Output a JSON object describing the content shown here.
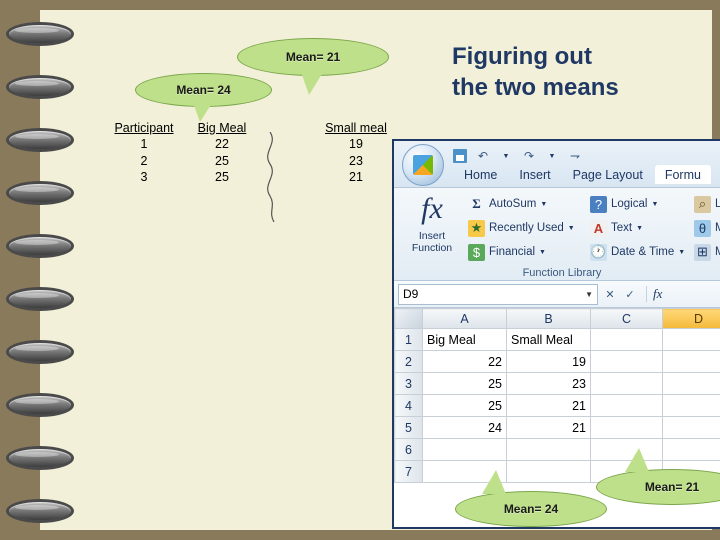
{
  "slide": {
    "title_line1": "Figuring out",
    "title_line2": "the two means",
    "title_color": "#1f3864",
    "background": "#f2f0d8",
    "page_background": "#8a7a5c"
  },
  "callouts": [
    {
      "id": "mean21-top",
      "label": "Mean= 21"
    },
    {
      "id": "mean24-top",
      "label": "Mean= 24"
    },
    {
      "id": "mean21-bottom",
      "label": "Mean= 21"
    },
    {
      "id": "mean24-bottom",
      "label": "Mean= 24"
    }
  ],
  "data_table": {
    "headers": [
      "Participant",
      "Big Meal",
      "",
      "Small meal"
    ],
    "rows": [
      [
        "1",
        "22",
        "",
        "19"
      ],
      [
        "2",
        "25",
        "",
        "23"
      ],
      [
        "3",
        "25",
        "",
        "21"
      ]
    ]
  },
  "excel": {
    "quick_access": [
      "save-icon",
      "undo-icon",
      "redo-icon",
      "customize-icon"
    ],
    "tabs": [
      {
        "label": "Home",
        "active": false
      },
      {
        "label": "Insert",
        "active": false
      },
      {
        "label": "Page Layout",
        "active": false
      },
      {
        "label": "Formu",
        "active": true
      }
    ],
    "ribbon": {
      "insert_function": {
        "glyph": "fx",
        "line1": "Insert",
        "line2": "Function"
      },
      "group_label": "Function Library",
      "column1": [
        {
          "label": "AutoSum",
          "icon": "sigma-icon",
          "dropdown": true
        },
        {
          "label": "Recently Used",
          "icon": "recently-used-icon",
          "dropdown": true
        },
        {
          "label": "Financial",
          "icon": "financial-icon",
          "dropdown": true
        }
      ],
      "column2": [
        {
          "label": "Logical",
          "icon": "logical-icon",
          "dropdown": true
        },
        {
          "label": "Text",
          "icon": "text-icon",
          "dropdown": true
        },
        {
          "label": "Date & Time",
          "icon": "date-time-icon",
          "dropdown": true
        }
      ],
      "column3": [
        {
          "label": "Lo",
          "icon": "lookup-icon",
          "dropdown": false
        },
        {
          "label": "Ma",
          "icon": "math-icon",
          "dropdown": false
        },
        {
          "label": "Mo",
          "icon": "more-functions-icon",
          "dropdown": false
        }
      ]
    },
    "formula_bar": {
      "name_box_value": "D9",
      "fx_label": "fx"
    },
    "grid": {
      "column_headers": [
        "A",
        "B",
        "C",
        "D"
      ],
      "selected_column": "D",
      "row_headers": [
        "1",
        "2",
        "3",
        "4",
        "5",
        "6",
        "7"
      ],
      "rows": [
        {
          "row": "1",
          "a": "Big Meal",
          "b": "Small Meal",
          "c": "",
          "d": "",
          "align": "txt"
        },
        {
          "row": "2",
          "a": "22",
          "b": "19",
          "c": "",
          "d": "",
          "align": "num"
        },
        {
          "row": "3",
          "a": "25",
          "b": "23",
          "c": "",
          "d": "",
          "align": "num"
        },
        {
          "row": "4",
          "a": "25",
          "b": "21",
          "c": "",
          "d": "",
          "align": "num"
        },
        {
          "row": "5",
          "a": "24",
          "b": "21",
          "c": "",
          "d": "",
          "align": "num"
        },
        {
          "row": "6",
          "a": "",
          "b": "",
          "c": "",
          "d": "",
          "align": "num"
        },
        {
          "row": "7",
          "a": "",
          "b": "",
          "c": "",
          "d": "",
          "align": "num"
        }
      ]
    }
  }
}
